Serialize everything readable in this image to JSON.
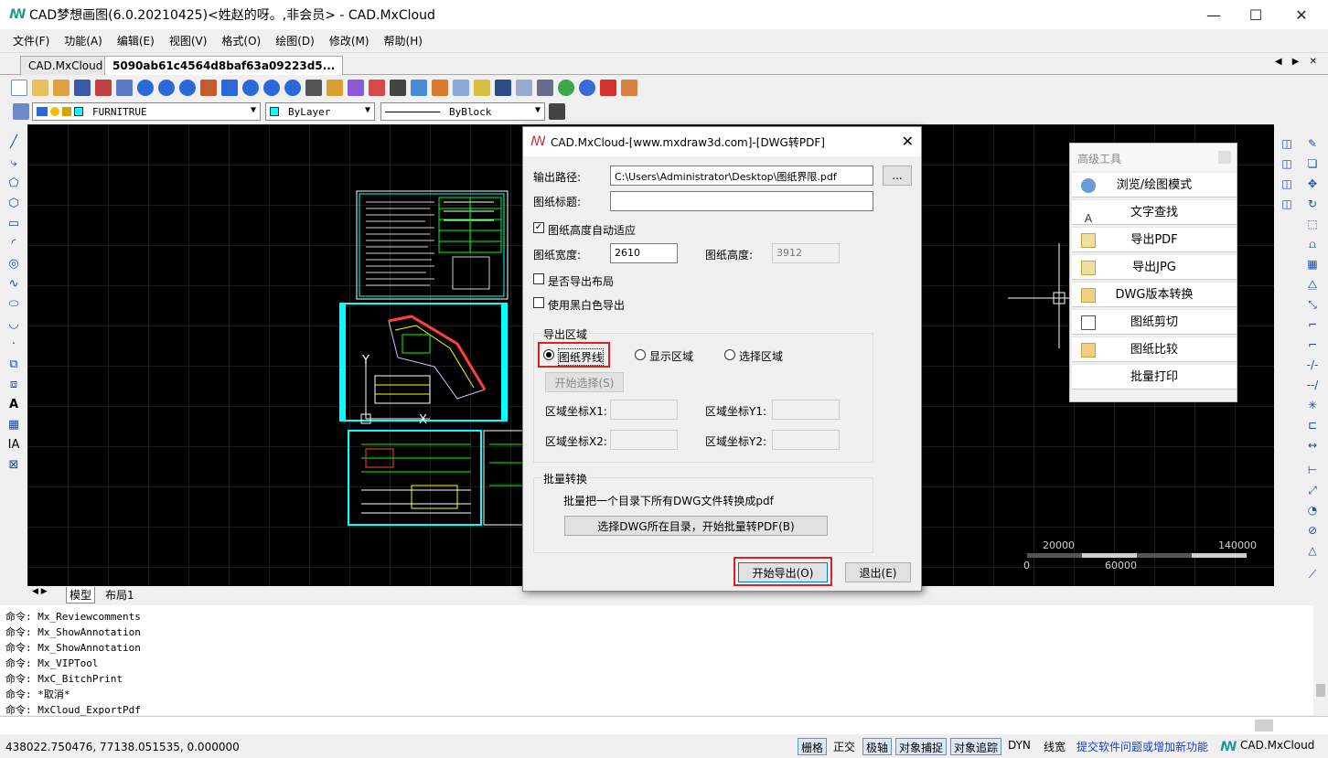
{
  "window": {
    "title": "CAD梦想画图(6.0.20210425)<姓赵的呀。,非会员> - CAD.MxCloud",
    "min": "—",
    "max": "☐",
    "close": "✕"
  },
  "menu": [
    "文件(F)",
    "功能(A)",
    "编辑(E)",
    "视图(V)",
    "格式(O)",
    "绘图(D)",
    "修改(M)",
    "帮助(H)"
  ],
  "doc_tabs": [
    "CAD.MxCloud",
    "5090ab61c4564d8baf63a09223d5..."
  ],
  "tab_nav": "◀ ▶ ✕",
  "layer_combo": "FURNITRUE",
  "color_combo": "ByLayer",
  "linetype_combo": "ByBlock",
  "layout_tabs": [
    "模型",
    "布局1"
  ],
  "layout_nav": "◀ ▶",
  "canvas": {
    "scale_left": "20000",
    "scale_right": "140000",
    "scale_zero": "0",
    "scale_mid": "60000",
    "axis_y": "Y",
    "axis_x": "X"
  },
  "dialog": {
    "title": "CAD.MxCloud-[www.mxdraw3d.com]-[DWG转PDF]",
    "close": "✕",
    "output_path_label": "输出路径:",
    "output_path_value": "C:\\Users\\Administrator\\Desktop\\图纸界限.pdf",
    "browse_label": "...",
    "sheet_title_label": "图纸标题:",
    "sheet_title_value": "",
    "auto_height_label": "图纸高度自动适应",
    "auto_height_checked": true,
    "width_label": "图纸宽度:",
    "width_value": "2610",
    "height_label": "图纸高度:",
    "height_value": "3912",
    "export_layout_label": "是否导出布局",
    "export_layout_checked": false,
    "bw_label": "使用黑白色导出",
    "bw_checked": false,
    "region_group": "导出区域",
    "region_options": [
      "图纸界线",
      "显示区域",
      "选择区域"
    ],
    "region_selected": "图纸界线",
    "start_select_label": "开始选择(S)",
    "x1_label": "区域坐标X1:",
    "y1_label": "区域坐标Y1:",
    "x2_label": "区域坐标X2:",
    "y2_label": "区域坐标Y2:",
    "batch_group": "批量转换",
    "batch_desc": "批量把一个目录下所有DWG文件转换成pdf",
    "batch_button": "选择DWG所在目录，开始批量转PDF(B)",
    "export_button": "开始导出(O)",
    "exit_button": "退出(E)"
  },
  "advanced_tools": {
    "title": "高级工具",
    "items": [
      "浏览/绘图模式",
      "文字查找",
      "导出PDF",
      "导出JPG",
      "DWG版本转换",
      "图纸剪切",
      "图纸比较",
      "批量打印"
    ]
  },
  "command_history": [
    "命令: Mx_Reviewcomments",
    "命令: Mx_ShowAnnotation",
    "命令: Mx_ShowAnnotation",
    "命令: Mx_VIPTool",
    "命令: MxC_BitchPrint",
    "命令:  *取消*",
    "命令: MxCloud_ExportPdf"
  ],
  "status": {
    "coords": "438022.750476, 77138.051535, 0.000000",
    "buttons": [
      "栅格",
      "正交",
      "极轴",
      "对象捕捉",
      "对象追踪",
      "DYN",
      "线宽"
    ],
    "buttons_on": [
      true,
      false,
      true,
      true,
      true,
      false,
      false
    ],
    "link": "提交软件问题或增加新功能",
    "brand": "CAD.MxCloud"
  },
  "colors": {
    "accent": "#1a9a8a",
    "red_highlight": "#e02020",
    "canvas": "#000000",
    "cad_cyan": "#00ffff",
    "cad_green": "#00ff00"
  }
}
